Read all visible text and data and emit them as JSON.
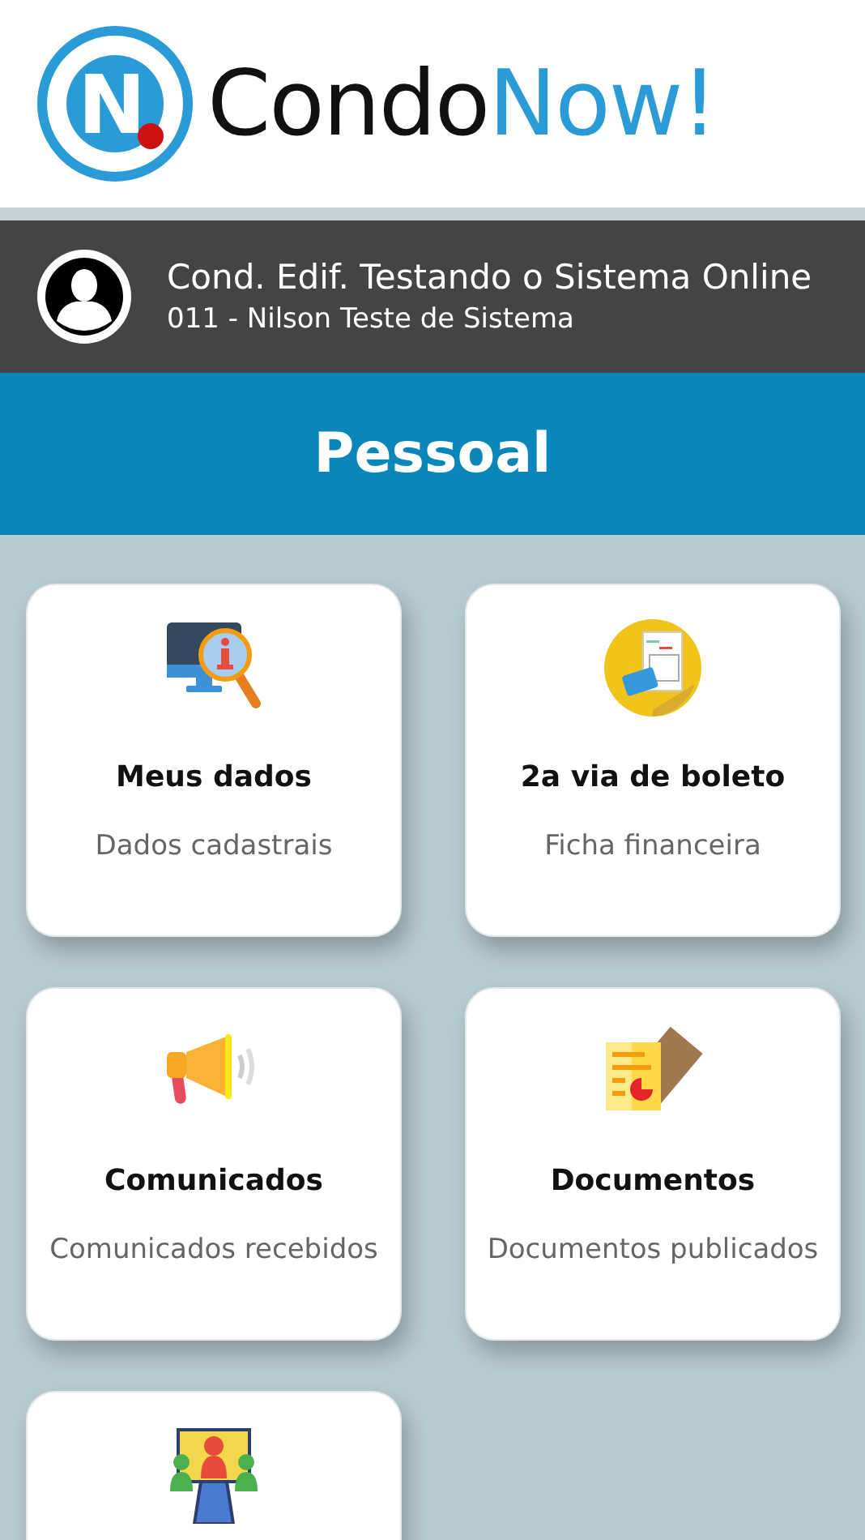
{
  "logo": {
    "mark_letter": "N",
    "word_1": "Condo",
    "word_2": "Now!"
  },
  "account": {
    "condominium": "Cond. Edif. Testando o Sistema Online",
    "unit": "011 - Nilson Teste de Sistema"
  },
  "section": {
    "title": "Pessoal"
  },
  "cards": [
    {
      "kind": "monitor-info",
      "title": "Meus dados",
      "subtitle": "Dados cadastrais"
    },
    {
      "kind": "invoice",
      "title": "2a via de boleto",
      "subtitle": "Ficha financeira"
    },
    {
      "kind": "megaphone",
      "title": "Comunicados",
      "subtitle": "Comunicados recebidos"
    },
    {
      "kind": "documents",
      "title": "Documentos",
      "subtitle": "Documentos publicados"
    },
    {
      "kind": "meeting"
    }
  ]
}
